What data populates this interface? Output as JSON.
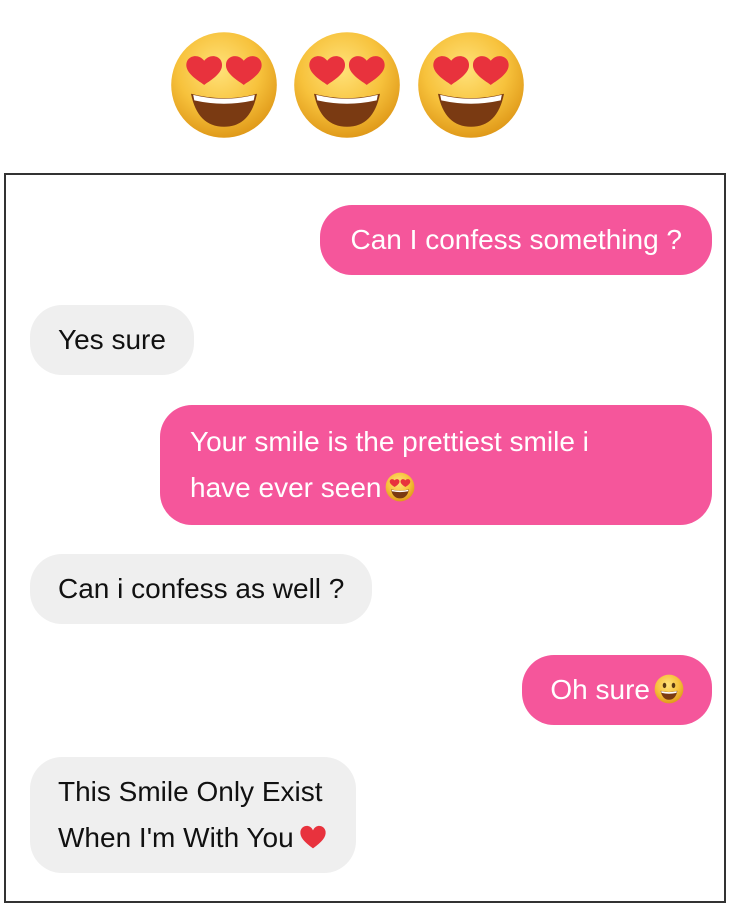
{
  "header": {
    "emojis": [
      "heart-eyes-emoji",
      "heart-eyes-emoji",
      "heart-eyes-emoji"
    ]
  },
  "colors": {
    "outgoing_bubble": "#f5569b",
    "incoming_bubble": "#efefef",
    "emoji_face": "#f9c440",
    "heart": "#e8323d"
  },
  "messages": [
    {
      "side": "outgoing",
      "lines": [
        "Can I confess something ?"
      ]
    },
    {
      "side": "incoming",
      "lines": [
        "Yes sure"
      ]
    },
    {
      "side": "outgoing",
      "lines": [
        "Your smile is the prettiest smile i",
        "have ever seen"
      ],
      "emoji": "heart-eyes-emoji"
    },
    {
      "side": "incoming",
      "lines": [
        "Can i confess as well ?"
      ]
    },
    {
      "side": "outgoing",
      "lines": [
        "Oh sure"
      ],
      "emoji": "grinning-emoji"
    },
    {
      "side": "incoming",
      "lines": [
        "This Smile Only Exist",
        "When I'm With You"
      ],
      "emoji": "red-heart-emoji"
    }
  ]
}
